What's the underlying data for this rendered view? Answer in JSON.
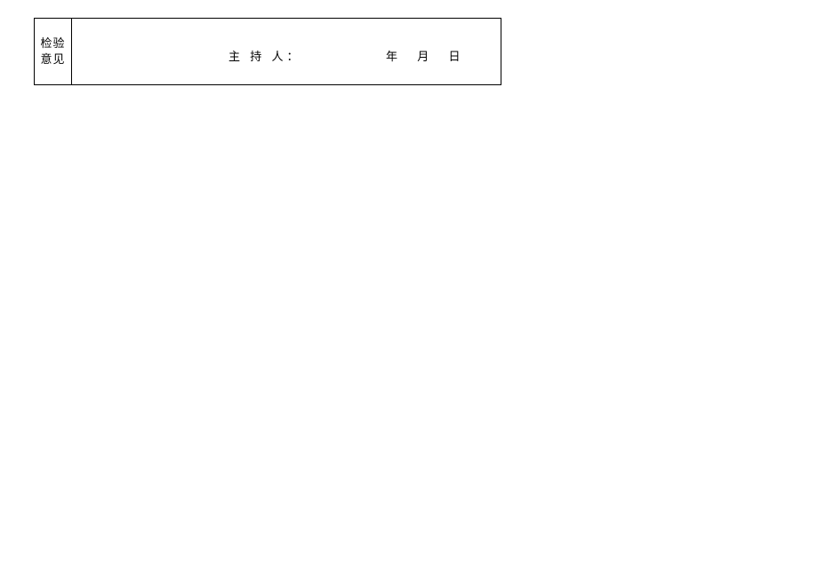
{
  "row": {
    "label_line1": "检验",
    "label_line2": "意见",
    "host_label": "主 持 人：",
    "date_year": "年",
    "date_month": "月",
    "date_day": "日"
  }
}
